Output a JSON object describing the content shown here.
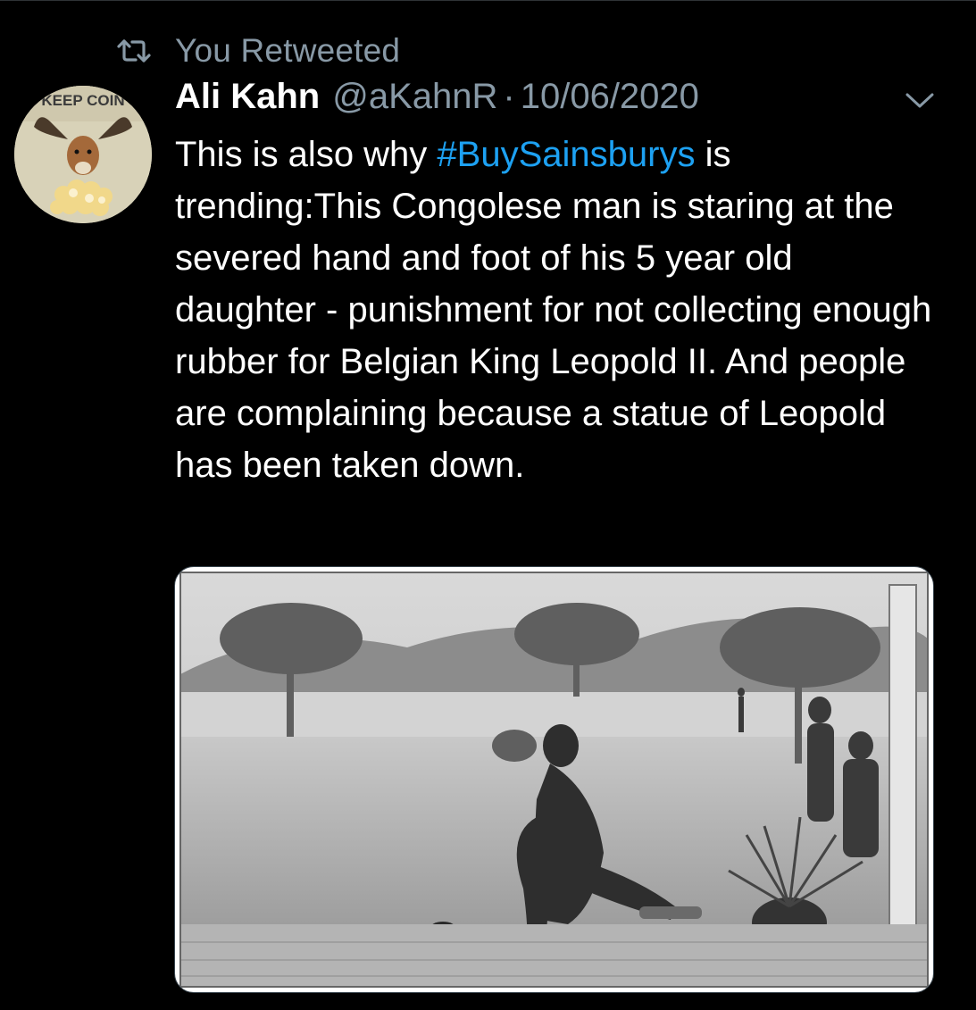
{
  "retweet": {
    "icon": "retweet-icon",
    "label": "You Retweeted"
  },
  "tweet": {
    "avatar": {
      "icon": "avatar-image",
      "badge_text": "KEEP COIN"
    },
    "author_name": "Ali Kahn",
    "author_handle": "@aKahnR",
    "separator": "·",
    "date": "10/06/2020",
    "menu_icon": "chevron-down-icon",
    "text_before": "This is also why ",
    "hashtag": "#BuySainsburys",
    "text_after": " is trending:This Congolese man is staring at the severed hand and foot of his 5 year old daughter - punishment for not collecting enough rubber for Belgian King Leopold II. And people are complaining because a statue of Leopold has been taken down.",
    "media": {
      "type": "black-and-white historical photograph"
    }
  },
  "colors": {
    "background": "#000000",
    "text_primary": "#ffffff",
    "text_secondary": "#8899a6",
    "link": "#1da1f2"
  }
}
